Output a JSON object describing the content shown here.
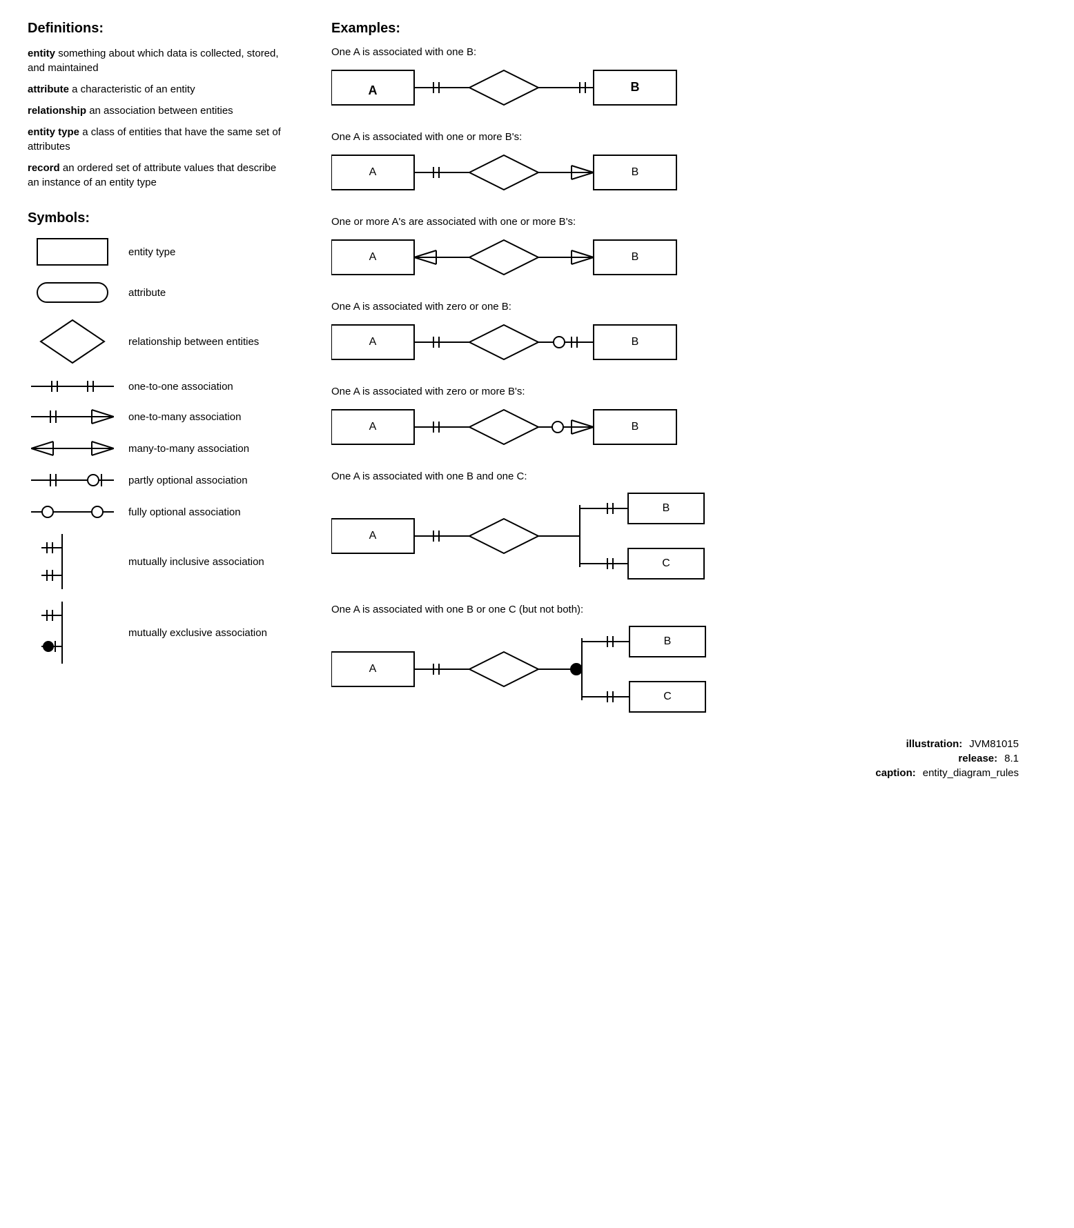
{
  "definitions": {
    "title": "Definitions:",
    "items": [
      {
        "term": "entity",
        "desc": " something about which data is collected, stored, and maintained"
      },
      {
        "term": "attribute",
        "desc": " a characteristic of an entity"
      },
      {
        "term": "relationship",
        "desc": " an association between entities"
      },
      {
        "term": "entity type",
        "desc": " a class of entities that have the same set of attributes"
      },
      {
        "term": "record",
        "desc": " an ordered set of attribute values that describe an instance of an entity type"
      }
    ]
  },
  "symbols": {
    "title": "Symbols:",
    "items": [
      {
        "id": "entity-type-symbol",
        "label": "entity type"
      },
      {
        "id": "attribute-symbol",
        "label": "attribute"
      },
      {
        "id": "relationship-symbol",
        "label": "relationship between entities"
      },
      {
        "id": "one-to-one-symbol",
        "label": "one-to-one association"
      },
      {
        "id": "one-to-many-symbol",
        "label": "one-to-many association"
      },
      {
        "id": "many-to-many-symbol",
        "label": "many-to-many association"
      },
      {
        "id": "partly-optional-symbol",
        "label": "partly optional association"
      },
      {
        "id": "fully-optional-symbol",
        "label": "fully optional association"
      },
      {
        "id": "mutually-inclusive-symbol",
        "label": "mutually inclusive association"
      },
      {
        "id": "mutually-exclusive-symbol",
        "label": "mutually exclusive association"
      }
    ]
  },
  "examples": {
    "title": "Examples:",
    "items": [
      {
        "id": "ex1",
        "label": "One A is associated with one B:"
      },
      {
        "id": "ex2",
        "label": "One A is associated with one or more B's:"
      },
      {
        "id": "ex3",
        "label": "One or more A's are associated with one or more B's:"
      },
      {
        "id": "ex4",
        "label": "One A is associated with zero or one B:"
      },
      {
        "id": "ex5",
        "label": "One A is associated with zero or more B's:"
      },
      {
        "id": "ex6",
        "label": "One A is associated with one B and one C:"
      },
      {
        "id": "ex7",
        "label": "One A is associated with one B or one C (but not both):"
      }
    ]
  },
  "footer": {
    "illustration_label": "illustration:",
    "illustration_value": "JVM81015",
    "release_label": "release:",
    "release_value": "8.1",
    "caption_label": "caption:",
    "caption_value": "entity_diagram_rules"
  }
}
